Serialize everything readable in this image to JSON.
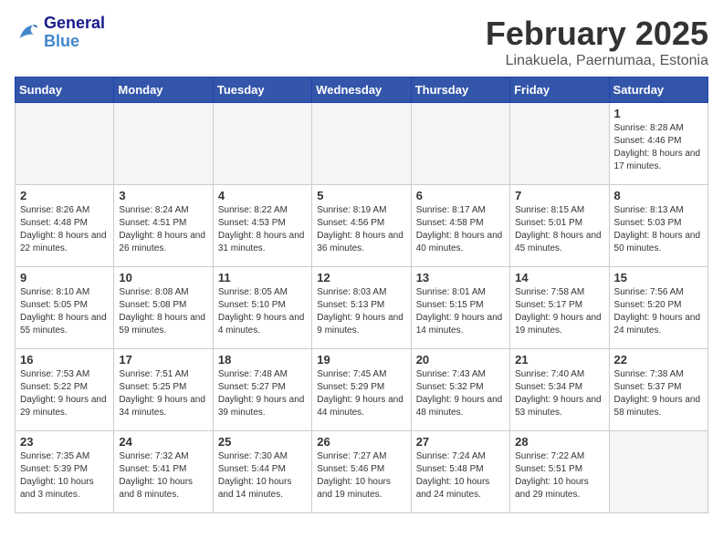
{
  "header": {
    "logo_line1": "General",
    "logo_line2": "Blue",
    "title": "February 2025",
    "subtitle": "Linakuela, Paernumaa, Estonia"
  },
  "days_of_week": [
    "Sunday",
    "Monday",
    "Tuesday",
    "Wednesday",
    "Thursday",
    "Friday",
    "Saturday"
  ],
  "weeks": [
    [
      {
        "day": "",
        "info": ""
      },
      {
        "day": "",
        "info": ""
      },
      {
        "day": "",
        "info": ""
      },
      {
        "day": "",
        "info": ""
      },
      {
        "day": "",
        "info": ""
      },
      {
        "day": "",
        "info": ""
      },
      {
        "day": "1",
        "info": "Sunrise: 8:28 AM\nSunset: 4:46 PM\nDaylight: 8 hours and 17 minutes."
      }
    ],
    [
      {
        "day": "2",
        "info": "Sunrise: 8:26 AM\nSunset: 4:48 PM\nDaylight: 8 hours and 22 minutes."
      },
      {
        "day": "3",
        "info": "Sunrise: 8:24 AM\nSunset: 4:51 PM\nDaylight: 8 hours and 26 minutes."
      },
      {
        "day": "4",
        "info": "Sunrise: 8:22 AM\nSunset: 4:53 PM\nDaylight: 8 hours and 31 minutes."
      },
      {
        "day": "5",
        "info": "Sunrise: 8:19 AM\nSunset: 4:56 PM\nDaylight: 8 hours and 36 minutes."
      },
      {
        "day": "6",
        "info": "Sunrise: 8:17 AM\nSunset: 4:58 PM\nDaylight: 8 hours and 40 minutes."
      },
      {
        "day": "7",
        "info": "Sunrise: 8:15 AM\nSunset: 5:01 PM\nDaylight: 8 hours and 45 minutes."
      },
      {
        "day": "8",
        "info": "Sunrise: 8:13 AM\nSunset: 5:03 PM\nDaylight: 8 hours and 50 minutes."
      }
    ],
    [
      {
        "day": "9",
        "info": "Sunrise: 8:10 AM\nSunset: 5:05 PM\nDaylight: 8 hours and 55 minutes."
      },
      {
        "day": "10",
        "info": "Sunrise: 8:08 AM\nSunset: 5:08 PM\nDaylight: 8 hours and 59 minutes."
      },
      {
        "day": "11",
        "info": "Sunrise: 8:05 AM\nSunset: 5:10 PM\nDaylight: 9 hours and 4 minutes."
      },
      {
        "day": "12",
        "info": "Sunrise: 8:03 AM\nSunset: 5:13 PM\nDaylight: 9 hours and 9 minutes."
      },
      {
        "day": "13",
        "info": "Sunrise: 8:01 AM\nSunset: 5:15 PM\nDaylight: 9 hours and 14 minutes."
      },
      {
        "day": "14",
        "info": "Sunrise: 7:58 AM\nSunset: 5:17 PM\nDaylight: 9 hours and 19 minutes."
      },
      {
        "day": "15",
        "info": "Sunrise: 7:56 AM\nSunset: 5:20 PM\nDaylight: 9 hours and 24 minutes."
      }
    ],
    [
      {
        "day": "16",
        "info": "Sunrise: 7:53 AM\nSunset: 5:22 PM\nDaylight: 9 hours and 29 minutes."
      },
      {
        "day": "17",
        "info": "Sunrise: 7:51 AM\nSunset: 5:25 PM\nDaylight: 9 hours and 34 minutes."
      },
      {
        "day": "18",
        "info": "Sunrise: 7:48 AM\nSunset: 5:27 PM\nDaylight: 9 hours and 39 minutes."
      },
      {
        "day": "19",
        "info": "Sunrise: 7:45 AM\nSunset: 5:29 PM\nDaylight: 9 hours and 44 minutes."
      },
      {
        "day": "20",
        "info": "Sunrise: 7:43 AM\nSunset: 5:32 PM\nDaylight: 9 hours and 48 minutes."
      },
      {
        "day": "21",
        "info": "Sunrise: 7:40 AM\nSunset: 5:34 PM\nDaylight: 9 hours and 53 minutes."
      },
      {
        "day": "22",
        "info": "Sunrise: 7:38 AM\nSunset: 5:37 PM\nDaylight: 9 hours and 58 minutes."
      }
    ],
    [
      {
        "day": "23",
        "info": "Sunrise: 7:35 AM\nSunset: 5:39 PM\nDaylight: 10 hours and 3 minutes."
      },
      {
        "day": "24",
        "info": "Sunrise: 7:32 AM\nSunset: 5:41 PM\nDaylight: 10 hours and 8 minutes."
      },
      {
        "day": "25",
        "info": "Sunrise: 7:30 AM\nSunset: 5:44 PM\nDaylight: 10 hours and 14 minutes."
      },
      {
        "day": "26",
        "info": "Sunrise: 7:27 AM\nSunset: 5:46 PM\nDaylight: 10 hours and 19 minutes."
      },
      {
        "day": "27",
        "info": "Sunrise: 7:24 AM\nSunset: 5:48 PM\nDaylight: 10 hours and 24 minutes."
      },
      {
        "day": "28",
        "info": "Sunrise: 7:22 AM\nSunset: 5:51 PM\nDaylight: 10 hours and 29 minutes."
      },
      {
        "day": "",
        "info": ""
      }
    ]
  ]
}
